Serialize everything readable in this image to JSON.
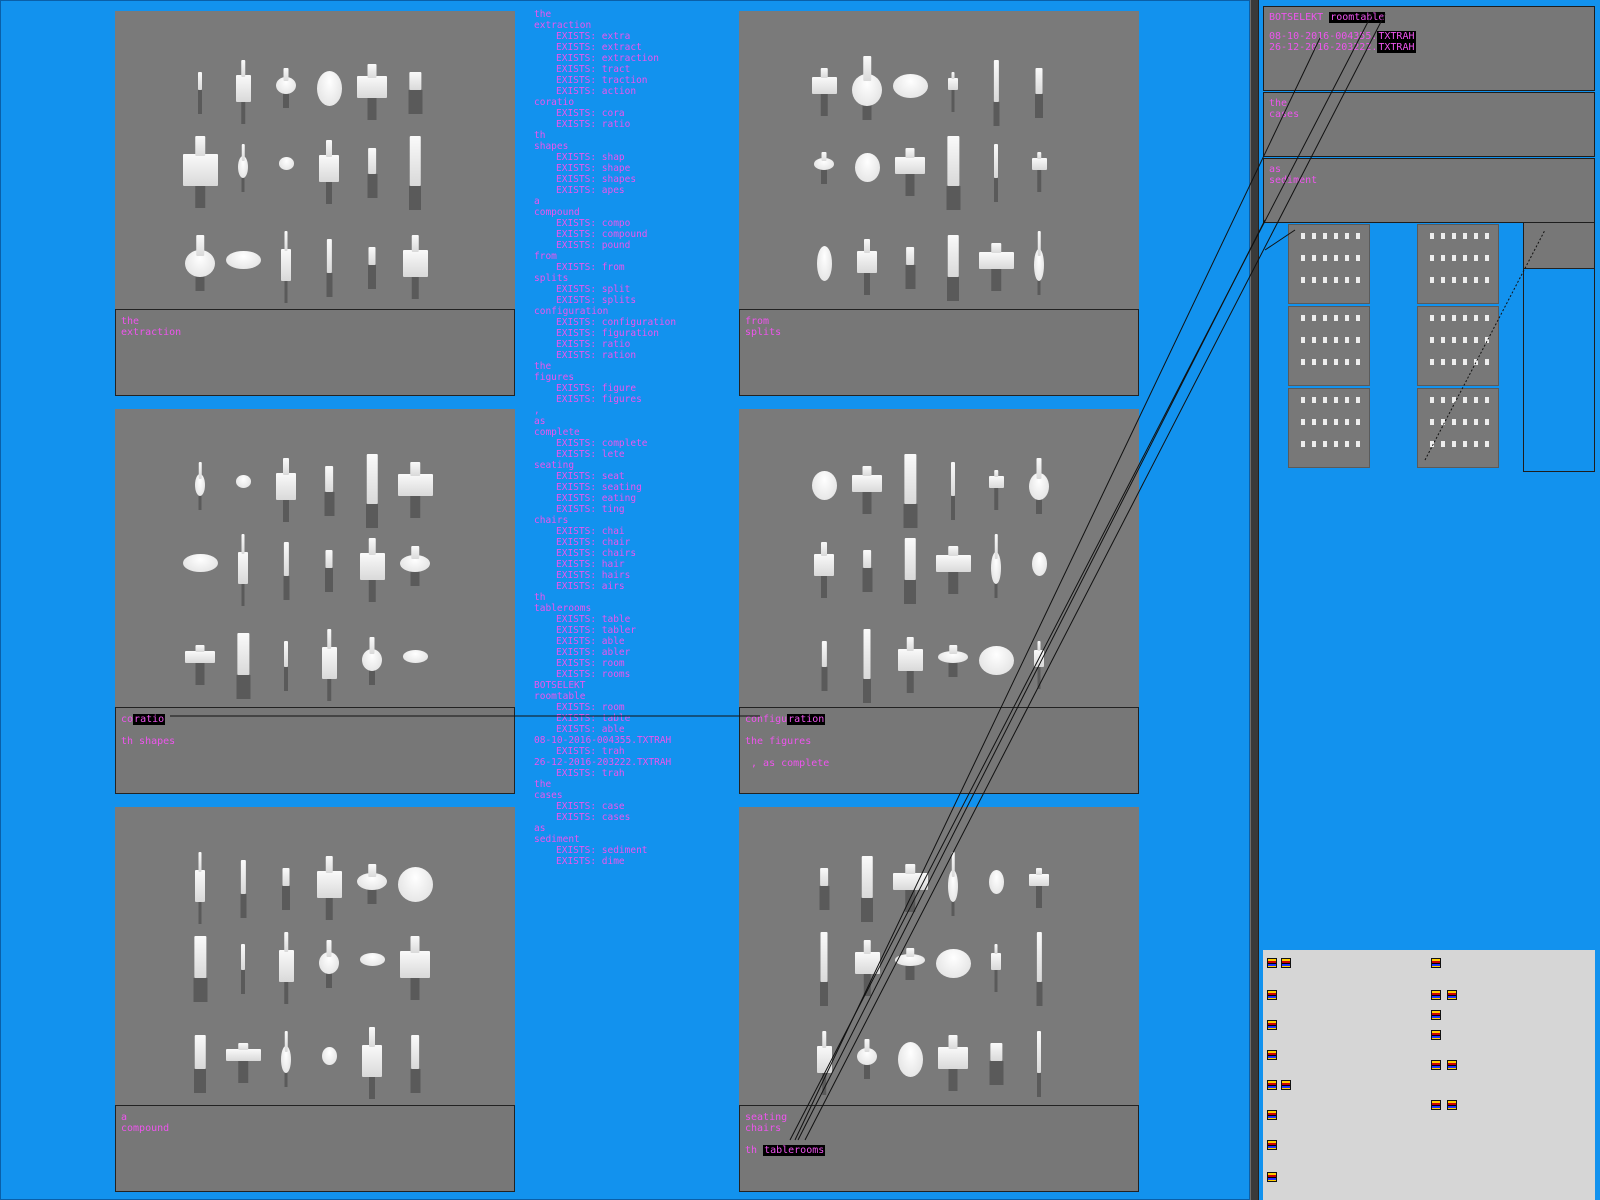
{
  "panels": [
    {
      "caption": [
        "the",
        "extraction"
      ],
      "hl": [],
      "label": "extraction"
    },
    {
      "caption": [
        "from",
        "splits"
      ],
      "hl": [],
      "label": "splits"
    },
    {
      "caption": [
        "coratio",
        "",
        "th shapes"
      ],
      "hl": [
        "ratio"
      ],
      "label": "coratio"
    },
    {
      "caption": [
        "configuration",
        "",
        "the figures",
        "",
        " , as complete"
      ],
      "hl": [
        "ration"
      ],
      "label": "configuration"
    },
    {
      "caption": [
        "a",
        "compound"
      ],
      "hl": [],
      "label": "compound"
    },
    {
      "caption": [
        "seating",
        "chairs",
        "",
        "th tablerooms"
      ],
      "hl": [
        "tablerooms"
      ],
      "label": "seating"
    }
  ],
  "log": [
    {
      "t": "the",
      "sub": false
    },
    {
      "t": "extraction",
      "sub": false
    },
    {
      "t": "EXISTS: extra",
      "sub": true
    },
    {
      "t": "EXISTS: extract",
      "sub": true
    },
    {
      "t": "EXISTS: extraction",
      "sub": true
    },
    {
      "t": "EXISTS: tract",
      "sub": true
    },
    {
      "t": "EXISTS: traction",
      "sub": true
    },
    {
      "t": "EXISTS: action",
      "sub": true
    },
    {
      "t": "coratio",
      "sub": false
    },
    {
      "t": "EXISTS: cora",
      "sub": true
    },
    {
      "t": "EXISTS: ratio",
      "sub": true
    },
    {
      "t": "th",
      "sub": false
    },
    {
      "t": "shapes",
      "sub": false
    },
    {
      "t": "EXISTS: shap",
      "sub": true
    },
    {
      "t": "EXISTS: shape",
      "sub": true
    },
    {
      "t": "EXISTS: shapes",
      "sub": true
    },
    {
      "t": "EXISTS: apes",
      "sub": true
    },
    {
      "t": "a",
      "sub": false
    },
    {
      "t": "compound",
      "sub": false
    },
    {
      "t": "EXISTS: compo",
      "sub": true
    },
    {
      "t": "EXISTS: compound",
      "sub": true
    },
    {
      "t": "EXISTS: pound",
      "sub": true
    },
    {
      "t": "from",
      "sub": false
    },
    {
      "t": "EXISTS: from",
      "sub": true
    },
    {
      "t": "splits",
      "sub": false
    },
    {
      "t": "EXISTS: split",
      "sub": true
    },
    {
      "t": "EXISTS: splits",
      "sub": true
    },
    {
      "t": "configuration",
      "sub": false
    },
    {
      "t": "EXISTS: configuration",
      "sub": true
    },
    {
      "t": "EXISTS: figuration",
      "sub": true
    },
    {
      "t": "EXISTS: ratio",
      "sub": true
    },
    {
      "t": "EXISTS: ration",
      "sub": true
    },
    {
      "t": "the",
      "sub": false
    },
    {
      "t": "figures",
      "sub": false
    },
    {
      "t": "EXISTS: figure",
      "sub": true
    },
    {
      "t": "EXISTS: figures",
      "sub": true
    },
    {
      "t": ",",
      "sub": false
    },
    {
      "t": "as",
      "sub": false
    },
    {
      "t": "complete",
      "sub": false
    },
    {
      "t": "EXISTS: complete",
      "sub": true
    },
    {
      "t": "EXISTS: lete",
      "sub": true
    },
    {
      "t": "seating",
      "sub": false
    },
    {
      "t": "EXISTS: seat",
      "sub": true
    },
    {
      "t": "EXISTS: seating",
      "sub": true
    },
    {
      "t": "EXISTS: eating",
      "sub": true
    },
    {
      "t": "EXISTS: ting",
      "sub": true
    },
    {
      "t": "chairs",
      "sub": false
    },
    {
      "t": "EXISTS: chai",
      "sub": true
    },
    {
      "t": "EXISTS: chair",
      "sub": true
    },
    {
      "t": "EXISTS: chairs",
      "sub": true
    },
    {
      "t": "EXISTS: hair",
      "sub": true
    },
    {
      "t": "EXISTS: hairs",
      "sub": true
    },
    {
      "t": "EXISTS: airs",
      "sub": true
    },
    {
      "t": "th",
      "sub": false
    },
    {
      "t": "tablerooms",
      "sub": false
    },
    {
      "t": "EXISTS: table",
      "sub": true
    },
    {
      "t": "EXISTS: tabler",
      "sub": true
    },
    {
      "t": "EXISTS: able",
      "sub": true
    },
    {
      "t": "EXISTS: abler",
      "sub": true
    },
    {
      "t": "EXISTS: room",
      "sub": true
    },
    {
      "t": "EXISTS: rooms",
      "sub": true
    },
    {
      "t": "BOTSELEKT",
      "sub": false
    },
    {
      "t": "roomtable",
      "sub": false
    },
    {
      "t": "EXISTS: room",
      "sub": true
    },
    {
      "t": "EXISTS: table",
      "sub": true
    },
    {
      "t": "EXISTS: able",
      "sub": true
    },
    {
      "t": "08-10-2016-004355.TXTRAH",
      "sub": false
    },
    {
      "t": "EXISTS: trah",
      "sub": true
    },
    {
      "t": "26-12-2016-203222.TXTRAH",
      "sub": false
    },
    {
      "t": "EXISTS: trah",
      "sub": true
    },
    {
      "t": "the",
      "sub": false
    },
    {
      "t": "cases",
      "sub": false
    },
    {
      "t": "EXISTS: case",
      "sub": true
    },
    {
      "t": "EXISTS: cases",
      "sub": true
    },
    {
      "t": "as",
      "sub": false
    },
    {
      "t": "sediment",
      "sub": false
    },
    {
      "t": "EXISTS: sediment",
      "sub": true
    },
    {
      "t": "EXISTS: dime",
      "sub": true
    }
  ],
  "sidebar": {
    "title_prefix": "BOTSELEKT",
    "title_hl": "roomtable",
    "files": [
      {
        "name": "08-10-2016-004355.",
        "hl": "TXTRAH"
      },
      {
        "name": "26-12-2016-203222.",
        "hl": "TXTRAH"
      }
    ],
    "box2": [
      "the",
      "cases"
    ],
    "box3": [
      "as",
      "sediment"
    ]
  },
  "colors": {
    "background": "#1292ee",
    "text": "#ee55ee",
    "render": "#7a7a7a",
    "caption": "#777777"
  }
}
